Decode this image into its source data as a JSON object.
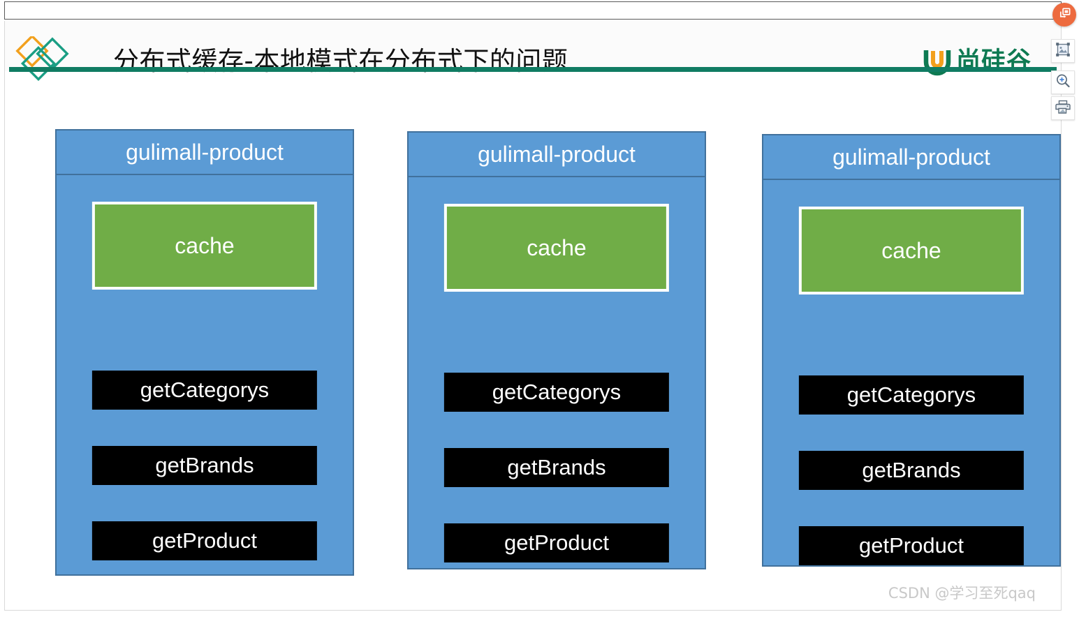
{
  "viewer": {
    "tools": [
      {
        "name": "copy-to-clipboard",
        "icon": "copy-icon",
        "label": ""
      },
      {
        "name": "resize-image",
        "icon": "image-icon",
        "label": ""
      },
      {
        "name": "zoom-in",
        "icon": "zoom-in-icon",
        "label": ""
      },
      {
        "name": "print",
        "icon": "printer-icon",
        "label": ""
      }
    ]
  },
  "slide": {
    "title": "分布式缓存-本地模式在分布式下的问题",
    "brand": {
      "name": "尚硅谷",
      "mark": "u-emblem-icon",
      "decoration": "three-diamonds-icon"
    },
    "colors": {
      "accent_rule": "#107c63",
      "box_fill": "#5b9bd5",
      "box_border": "#41719c",
      "cache_fill": "#70ad47",
      "method_fill": "#000000",
      "brand_green": "#0e7a52",
      "brand_orange": "#f2a01d",
      "tool_badge": "#ed6b3f"
    },
    "services": [
      {
        "title": "gulimall-product",
        "cache": "cache",
        "methods": [
          "getCategorys",
          "getBrands",
          "getProduct"
        ]
      },
      {
        "title": "gulimall-product",
        "cache": "cache",
        "methods": [
          "getCategorys",
          "getBrands",
          "getProduct"
        ]
      },
      {
        "title": "gulimall-product",
        "cache": "cache",
        "methods": [
          "getCategorys",
          "getBrands",
          "getProduct"
        ]
      }
    ]
  },
  "watermark": "CSDN @学习至死qaq"
}
